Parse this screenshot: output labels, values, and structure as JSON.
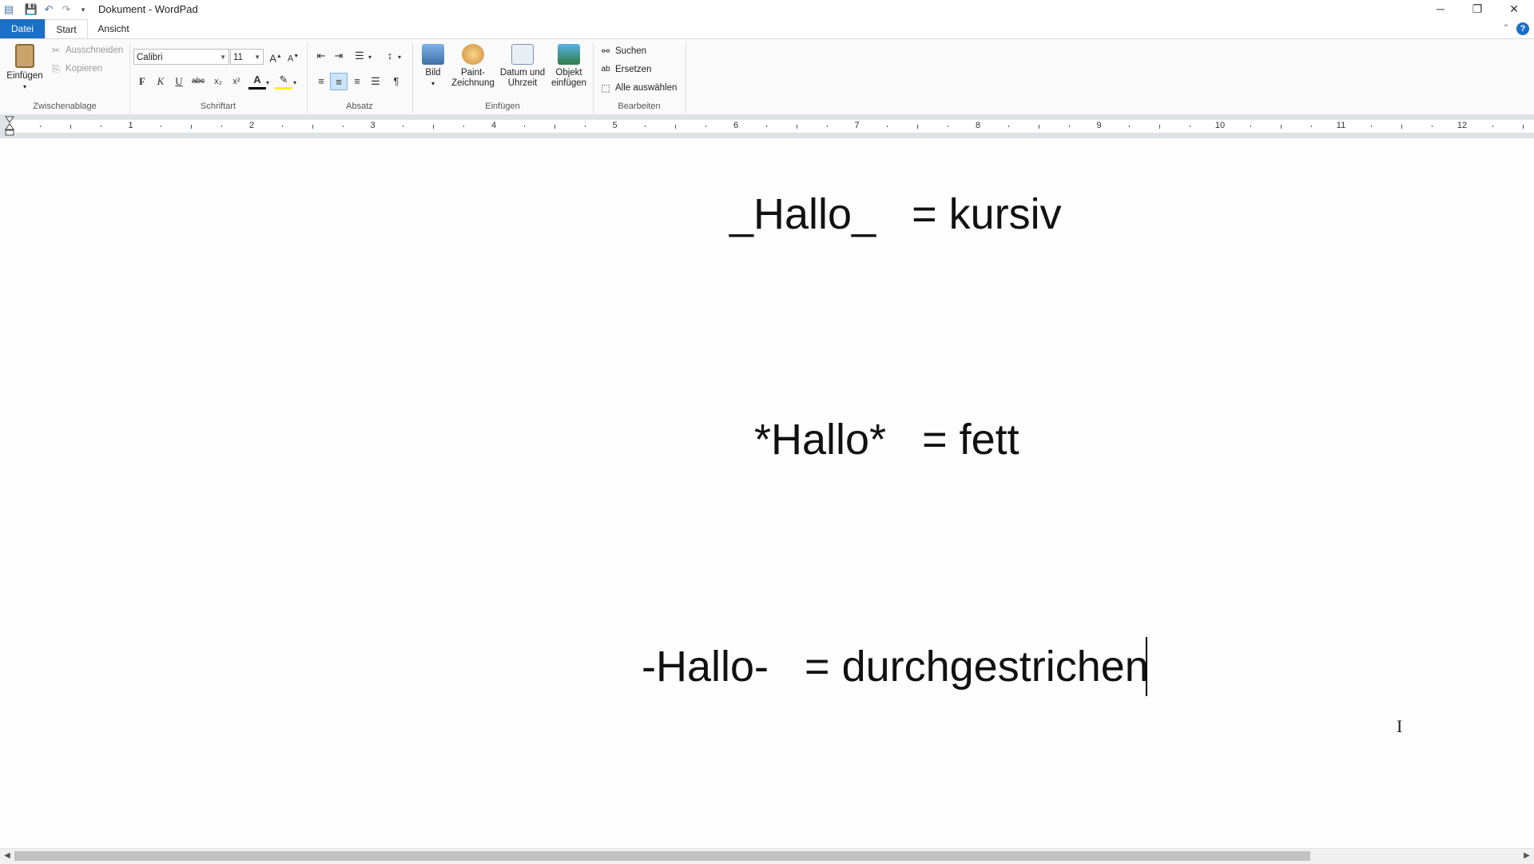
{
  "window": {
    "title": "Dokument - WordPad",
    "minimize_symbol": "─",
    "restore_symbol": "❐",
    "close_symbol": "✕"
  },
  "quick_access": {
    "items": [
      "app-menu-icon",
      "save-icon",
      "undo-icon",
      "redo-icon",
      "customize-icon"
    ]
  },
  "tabs": {
    "datei": "Datei",
    "start": "Start",
    "ansicht": "Ansicht"
  },
  "ribbon": {
    "clipboard": {
      "label": "Zwischenablage",
      "paste": "Einfügen",
      "cut": "Ausschneiden",
      "copy": "Kopieren"
    },
    "font": {
      "label": "Schriftart",
      "family": "Calibri",
      "size": "11",
      "bold": "F",
      "italic": "K",
      "underline": "U",
      "strikethrough": "abc",
      "subscript": "x₂",
      "superscript": "x²",
      "font_color": "A"
    },
    "paragraph": {
      "label": "Absatz"
    },
    "insert": {
      "label": "Einfügen",
      "picture": "Bild",
      "paint_line1": "Paint-",
      "paint_line2": "Zeichnung",
      "datetime_line1": "Datum und",
      "datetime_line2": "Uhrzeit",
      "object_line1": "Objekt",
      "object_line2": "einfügen"
    },
    "editing": {
      "label": "Bearbeiten",
      "find": "Suchen",
      "replace": "Ersetzen",
      "select_all": "Alle auswählen"
    }
  },
  "ruler": {
    "numbers": [
      "1",
      "2",
      "3",
      "4",
      "5",
      "6",
      "7",
      "8",
      "9",
      "10",
      "11",
      "12"
    ]
  },
  "document": {
    "line1": "_Hallo_   = kursiv",
    "line2": "*Hallo*   = fett",
    "line3": "-Hallo-   = durchgestrichen"
  },
  "colors": {
    "accent": "#1a6fc6",
    "ribbon_bg": "#fafafa",
    "ruler_bg": "#dfe3e8"
  }
}
